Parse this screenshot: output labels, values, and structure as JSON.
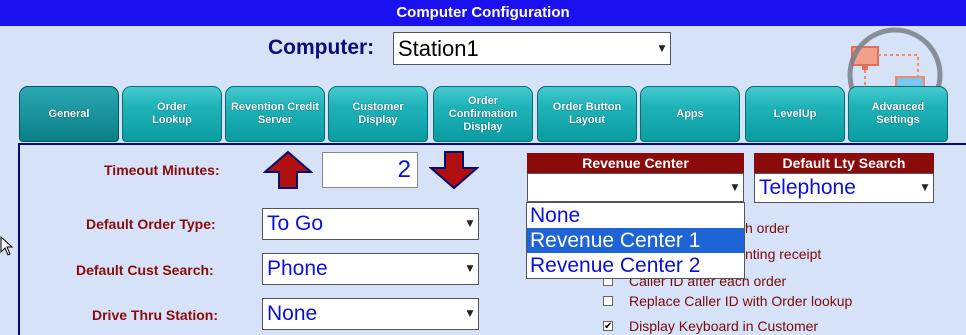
{
  "window": {
    "title": "Computer Configuration"
  },
  "computer": {
    "label": "Computer:",
    "value": "Station1"
  },
  "tabs": [
    {
      "label": "General",
      "active": true
    },
    {
      "label": "Order Lookup"
    },
    {
      "label": "Revention Credit Server"
    },
    {
      "label": "Customer Display"
    },
    {
      "label": "Order Confirmation Display"
    },
    {
      "label": "Order Button Layout"
    },
    {
      "label": "Apps"
    },
    {
      "label": "LevelUp"
    },
    {
      "label": "Advanced Settings"
    }
  ],
  "general": {
    "timeout": {
      "label": "Timeout Minutes:",
      "value": "2"
    },
    "order_type": {
      "label": "Default Order Type:",
      "value": "To Go"
    },
    "cust_search": {
      "label": "Default Cust Search:",
      "value": "Phone"
    },
    "drive_thru": {
      "label": "Drive Thru Station:",
      "value": "None"
    }
  },
  "revenue_center": {
    "header": "Revenue Center",
    "value": "",
    "options": [
      "None",
      "Revenue Center 1",
      "Revenue Center 2"
    ],
    "highlighted_index": 1
  },
  "lty_search": {
    "header": "Default Lty Search",
    "value": "Telephone"
  },
  "options": [
    {
      "label": "h order",
      "checked": false
    },
    {
      "label": "nting receipt",
      "checked": false
    },
    {
      "label": "Caller ID after each order",
      "checked": false
    },
    {
      "label": "Replace Caller ID with Order lookup",
      "checked": false
    },
    {
      "label": "Display Keyboard in Customer",
      "checked": true
    }
  ],
  "colors": {
    "title_bar": "#1a10f0",
    "background": "#d6e2f7",
    "tab_teal": "#1fb3b8",
    "header_red": "#8b0a0a",
    "label_red": "#8b0b0b",
    "field_blue": "#0a10d8",
    "selection_blue": "#1e64d6"
  }
}
